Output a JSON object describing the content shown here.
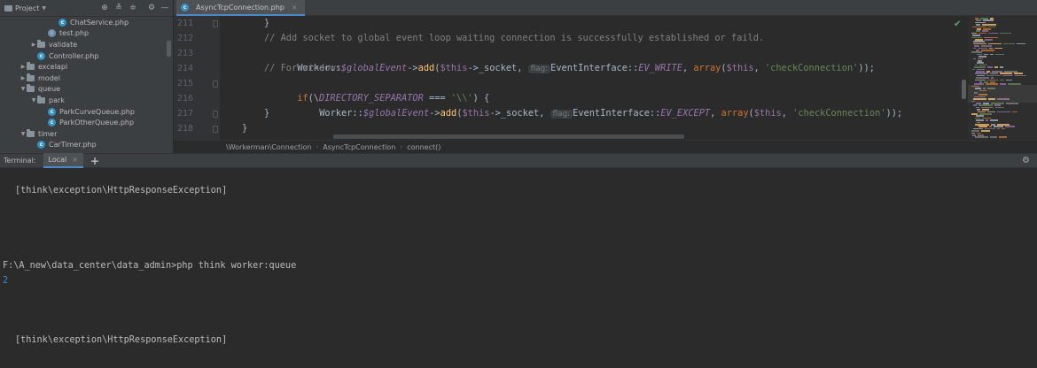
{
  "project_panel": {
    "title": "Project",
    "tree": [
      {
        "label": "ChatService.php",
        "indent": 4,
        "type": "php",
        "expanded": null
      },
      {
        "label": "test.php",
        "indent": 3,
        "type": "php-plain",
        "expanded": null
      },
      {
        "label": "validate",
        "indent": 2,
        "type": "folder",
        "expanded": false
      },
      {
        "label": "Controller.php",
        "indent": 2,
        "type": "php",
        "expanded": null
      },
      {
        "label": "excelapi",
        "indent": 1,
        "type": "folder",
        "expanded": false
      },
      {
        "label": "model",
        "indent": 1,
        "type": "folder",
        "expanded": false
      },
      {
        "label": "queue",
        "indent": 1,
        "type": "folder",
        "expanded": true
      },
      {
        "label": "park",
        "indent": 2,
        "type": "folder",
        "expanded": true
      },
      {
        "label": "ParkCurveQueue.php",
        "indent": 3,
        "type": "php",
        "expanded": null
      },
      {
        "label": "ParkOtherQueue.php",
        "indent": 3,
        "type": "php",
        "expanded": null
      },
      {
        "label": "timer",
        "indent": 1,
        "type": "folder",
        "expanded": true
      },
      {
        "label": "CarTimer.php",
        "indent": 2,
        "type": "php",
        "expanded": null
      }
    ]
  },
  "editor": {
    "tab_label": "AsyncTcpConnection.php",
    "line_numbers": [
      "211",
      "212",
      "213",
      "214",
      "215",
      "216",
      "217",
      "218"
    ],
    "code": {
      "l211": "}",
      "l212": "// Add socket to global event loop waiting connection is successfully established or faild.",
      "l213": {
        "cls": "Worker::",
        "var": "$globalEvent",
        "arrow": "->",
        "fn": "add",
        "open": "(",
        "this": "$this",
        "prop": "->_socket,",
        "hint": "flag:",
        "iface": "EventInterface::",
        "const": "EV_WRITE",
        "comma": ",",
        "arr": "array",
        "open2": "(",
        "this2": "$this",
        "comma2": ",",
        "str": "'checkConnection'",
        "close": "));"
      },
      "l214": "// For windows.",
      "l215": {
        "kw": "if",
        "open": "(\\",
        "const": "DIRECTORY_SEPARATOR",
        "op": " === ",
        "str": "'\\\\'",
        "close": ") {"
      },
      "l216": {
        "cls": "Worker::",
        "var": "$globalEvent",
        "arrow": "->",
        "fn": "add",
        "open": "(",
        "this": "$this",
        "prop": "->_socket,",
        "hint": "flag:",
        "iface": "EventInterface::",
        "const": "EV_EXCEPT",
        "comma": ",",
        "arr": "array",
        "open2": "(",
        "this2": "$this",
        "comma2": ",",
        "str": "'checkConnection'",
        "close": "));"
      },
      "l217": "}",
      "l218": "}"
    },
    "breadcrumbs": [
      "\\Workerman\\Connection",
      "AsyncTcpConnection",
      "connect()"
    ]
  },
  "terminal": {
    "title": "Terminal:",
    "tab_label": "Local",
    "add_label": "+",
    "lines": [
      {
        "text": "[think\\exception\\HttpResponseException]",
        "indent": true
      },
      {
        "text": "F:\\A_new\\data_center\\data_admin>php think worker:queue",
        "indent": false
      },
      {
        "text": "2",
        "indent": false
      },
      {
        "text": "[think\\exception\\HttpResponseException]",
        "indent": true
      }
    ]
  },
  "colors": {
    "accent": "#4a88c7",
    "background": "#2b2b2b",
    "panel": "#3c3f41"
  }
}
